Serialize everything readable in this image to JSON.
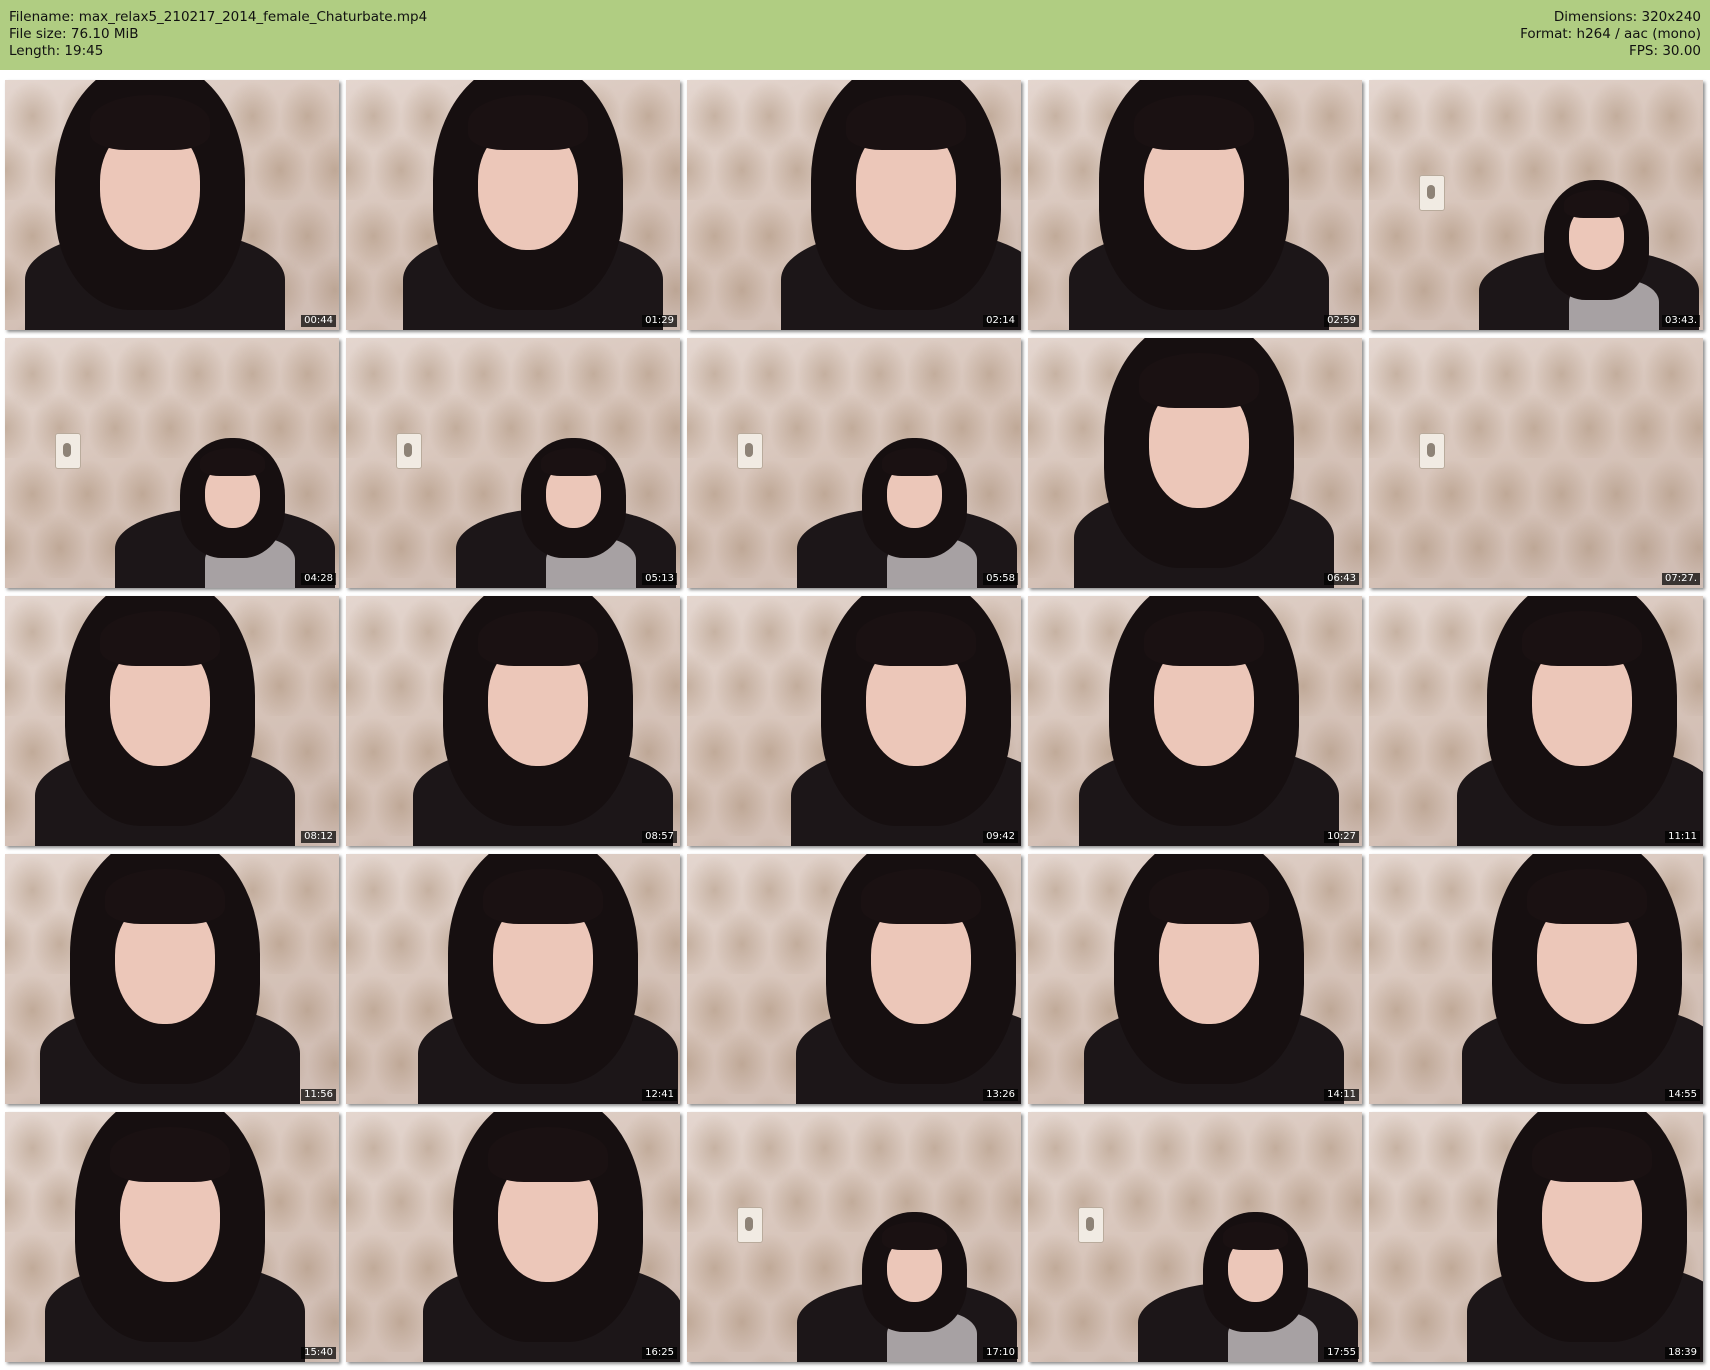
{
  "header": {
    "filename_line": "Filename: max_relax5_210217_2014_female_Chaturbate.mp4",
    "filesize_line": "File size: 76.10 MiB",
    "length_line": "Length: 19:45",
    "dimensions_line": "Dimensions: 320x240",
    "format_line": "Format: h264 / aac (mono)",
    "fps_line": "FPS: 30.00",
    "background_color": "#b0cd82"
  },
  "thumbnails": [
    {
      "timestamp": "00:44"
    },
    {
      "timestamp": "01:29"
    },
    {
      "timestamp": "02:14"
    },
    {
      "timestamp": "02:59"
    },
    {
      "timestamp": "03:43."
    },
    {
      "timestamp": "04:28"
    },
    {
      "timestamp": "05:13"
    },
    {
      "timestamp": "05:58"
    },
    {
      "timestamp": "06:43"
    },
    {
      "timestamp": "07:27."
    },
    {
      "timestamp": "08:12"
    },
    {
      "timestamp": "08:57"
    },
    {
      "timestamp": "09:42"
    },
    {
      "timestamp": "10:27"
    },
    {
      "timestamp": "11:11"
    },
    {
      "timestamp": "11:56"
    },
    {
      "timestamp": "12:41"
    },
    {
      "timestamp": "13:26"
    },
    {
      "timestamp": "14:11"
    },
    {
      "timestamp": "14:55"
    },
    {
      "timestamp": "15:40"
    },
    {
      "timestamp": "16:25"
    },
    {
      "timestamp": "17:10"
    },
    {
      "timestamp": "17:55"
    },
    {
      "timestamp": "18:39"
    }
  ]
}
